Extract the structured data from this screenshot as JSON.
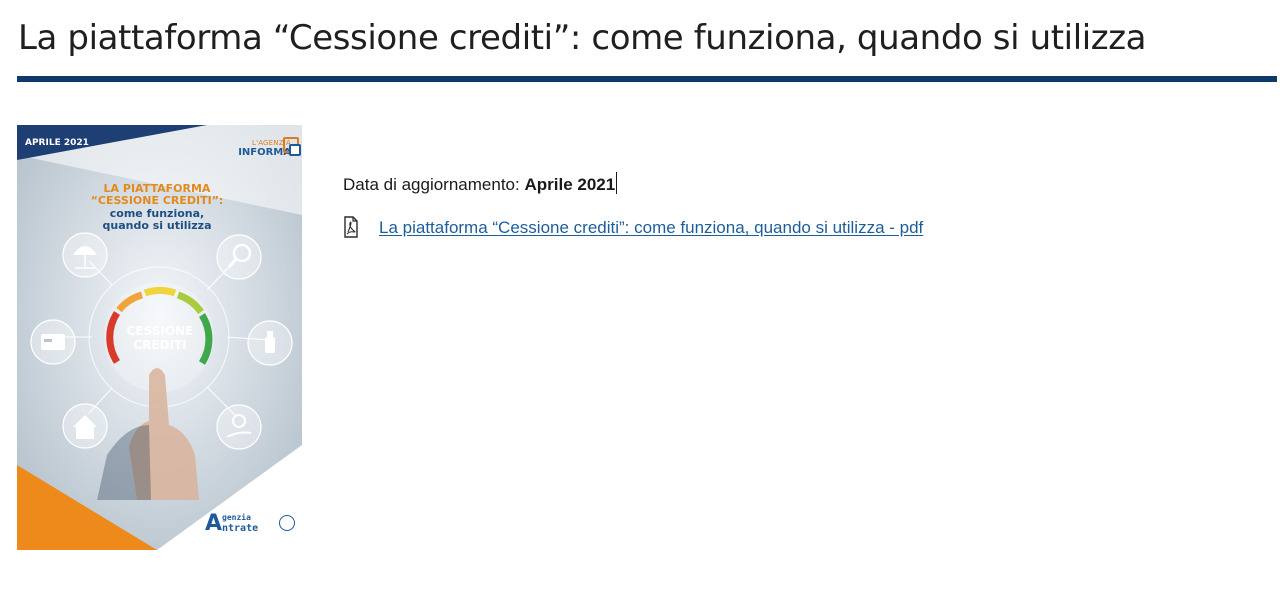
{
  "page": {
    "title": "La piattaforma “Cessione crediti”: come funziona, quando si utilizza"
  },
  "cover": {
    "month": "APRILE 2021",
    "brand_top": "L'AGENZIA",
    "brand_bottom": "INFORMA",
    "headline_1": "LA PIATTAFORMA",
    "headline_2": "“CESSIONE CREDITI”:",
    "headline_3": "come funziona,",
    "headline_4": "quando si utilizza",
    "center_line_1": "CESSIONE",
    "center_line_2": "CREDITI",
    "agency_top": "genzia",
    "agency_bottom": "ntrate",
    "agency_initial": "A",
    "colors": {
      "dark_blue": "#1d3f73",
      "orange": "#ee8a1c"
    }
  },
  "details": {
    "updated_label": "Data di aggiornamento:",
    "updated_value": "Aprile 2021",
    "document_link": "La piattaforma “Cessione crediti”: come funziona, quando si utilizza - pdf",
    "document_icon": "pdf-icon"
  },
  "theme": {
    "rule_color": "#0d3a6b",
    "link_color": "#1e5d9b"
  }
}
